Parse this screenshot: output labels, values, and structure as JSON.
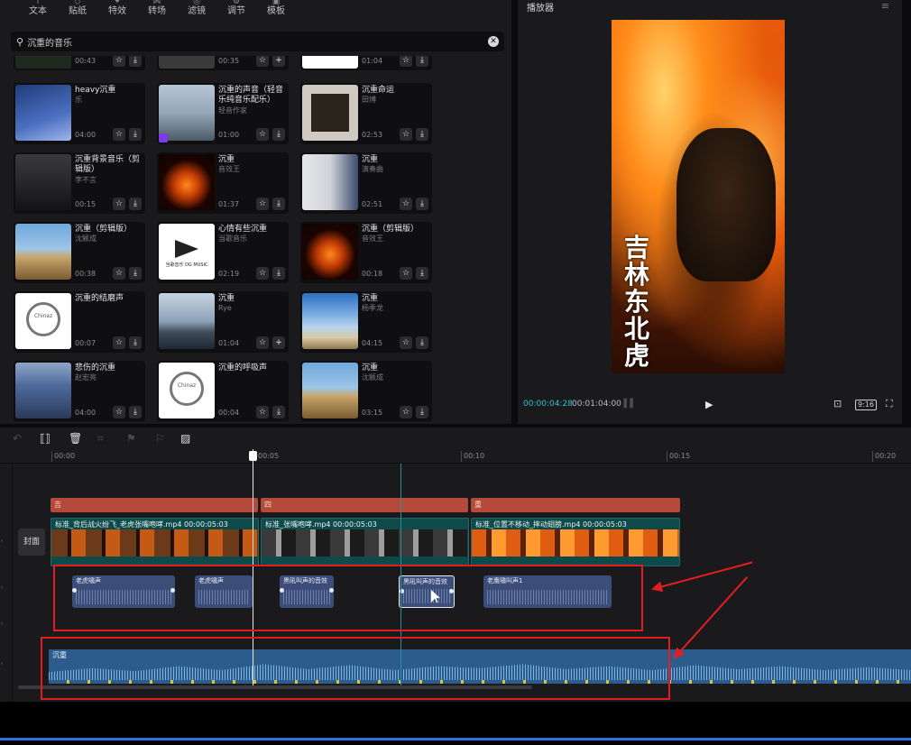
{
  "tabs": [
    "文本",
    "贴纸",
    "特效",
    "转场",
    "滤镜",
    "调节",
    "模板"
  ],
  "search": {
    "value": "沉重的音乐"
  },
  "music_cards": [
    {
      "title": "",
      "artist": "",
      "duration": "00:43",
      "thumb": "th-partial"
    },
    {
      "title": "",
      "artist": "",
      "duration": "00:35",
      "thumb": "th-partial2"
    },
    {
      "title": "",
      "artist": "",
      "duration": "01:04",
      "thumb": "th-white"
    },
    {
      "title": "heavy沉重",
      "artist": "乐",
      "duration": "04:00",
      "thumb": "th-night"
    },
    {
      "title": "沉重的声音（轻音乐纯音乐配乐）",
      "artist": "轻音作家",
      "duration": "01:00",
      "thumb": "th-road",
      "badge": true
    },
    {
      "title": "沉重命运",
      "artist": "田博",
      "duration": "02:53",
      "thumb": "th-album"
    },
    {
      "title": "沉重背景音乐（剪辑版）",
      "artist": "李不言",
      "duration": "00:15",
      "thumb": "th-umbrella"
    },
    {
      "title": "沉重",
      "artist": "音效王",
      "duration": "01:37",
      "thumb": "th-fire"
    },
    {
      "title": "沉重",
      "artist": "演奏曲",
      "duration": "02:51",
      "thumb": "th-portrait"
    },
    {
      "title": "沉重（剪辑版）",
      "artist": "沈颖成",
      "duration": "00:38",
      "thumb": "th-tent"
    },
    {
      "title": "心情有些沉重",
      "artist": "当歌音乐",
      "duration": "02:19",
      "thumb": "th-logo",
      "logo_text": "当歌音乐 DG MUSIC"
    },
    {
      "title": "沉重（剪辑版）",
      "artist": "音效王",
      "duration": "00:18",
      "thumb": "th-fire"
    },
    {
      "title": "沉重的结磨声",
      "artist": "",
      "duration": "00:07",
      "thumb": "th-headphone",
      "logo_text": "Chinaz"
    },
    {
      "title": "沉重",
      "artist": "Rye",
      "duration": "01:04",
      "thumb": "th-sea"
    },
    {
      "title": "沉重",
      "artist": "杨季龙",
      "duration": "04:15",
      "thumb": "th-beach"
    },
    {
      "title": "悲伤的沉重",
      "artist": "赵宏亮",
      "duration": "04:00",
      "thumb": "th-palace"
    },
    {
      "title": "沉重的呼吸声",
      "artist": "",
      "duration": "00:04",
      "thumb": "th-headphone",
      "logo_text": "Chinaz"
    },
    {
      "title": "沉重",
      "artist": "沈颖成",
      "duration": "03:15",
      "thumb": "th-tent"
    }
  ],
  "player": {
    "title": "播放器",
    "caption": "吉林东北虎",
    "time_current": "00:00:04:28",
    "time_total": "00:01:04:00",
    "ratio": "9:16"
  },
  "timeline": {
    "ticks": [
      "00:00",
      "00:05",
      "00:10",
      "00:15",
      "00:20"
    ],
    "segment_labels": [
      "吉",
      "四",
      "重"
    ],
    "cover_label": "封面",
    "video_clips": [
      {
        "title": "标准_背后战火纷飞_老虎张嘴咆哮.mp4   00:00:05:03",
        "frames": "frames-tiger"
      },
      {
        "title": "标准_张嘴咆哮.mp4   00:00:05:03",
        "frames": "frames-panda"
      },
      {
        "title": "标准_位置不移动_摔动翅膀.mp4   00:00:05:03",
        "frames": "frames-fire"
      }
    ],
    "audio_clips": [
      {
        "title": "老虎嘯声"
      },
      {
        "title": "老虎嘯声"
      },
      {
        "title": "黑吼叫声的音效"
      },
      {
        "title": "黑吼叫声的音效"
      },
      {
        "title": "老鹰嘯叫声1"
      }
    ],
    "music_title": "沉重"
  },
  "colors": {
    "accent": "#2ec4c9",
    "annotation": "#e11d24",
    "music_track": "#2c5c8c",
    "segment": "#b54a3a"
  }
}
